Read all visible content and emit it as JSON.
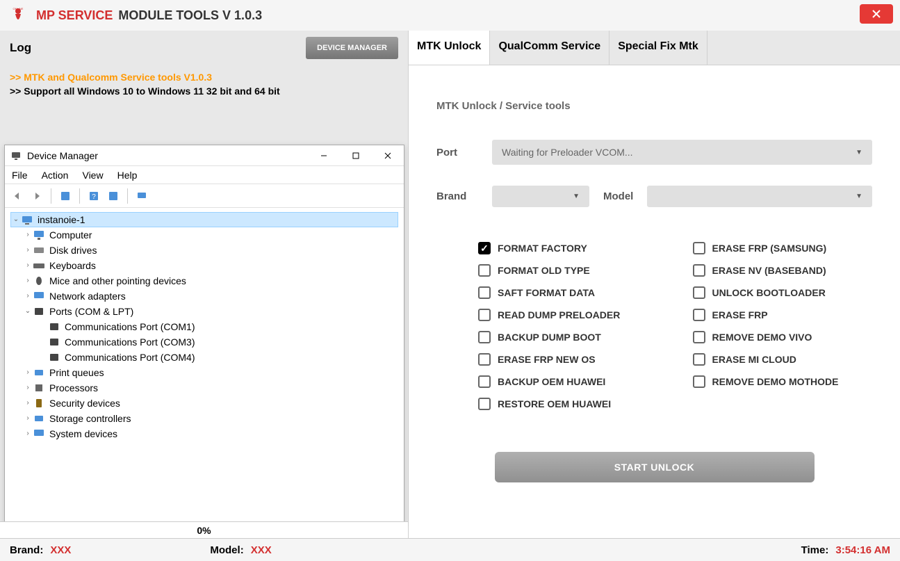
{
  "titlebar": {
    "main": "MP SERVICE",
    "sub": "MODULE TOOLS V 1.0.3",
    "logo_label": "ONLINE"
  },
  "left": {
    "log_label": "Log",
    "device_manager_btn": "DEVICE MANAGER",
    "log_lines": {
      "line1": ">> MTK and Qualcomm Service tools V1.0.3",
      "line2": ">> Support all Windows 10 to Windows 11 32 bit and 64 bit"
    },
    "progress": "0%"
  },
  "devmgr": {
    "title": "Device Manager",
    "menu": {
      "file": "File",
      "action": "Action",
      "view": "View",
      "help": "Help"
    },
    "root": "instanoie-1",
    "nodes": [
      {
        "label": "Computer",
        "icon": "monitor"
      },
      {
        "label": "Disk drives",
        "icon": "disk"
      },
      {
        "label": "Keyboards",
        "icon": "keyboard"
      },
      {
        "label": "Mice and other pointing devices",
        "icon": "mouse"
      },
      {
        "label": "Network adapters",
        "icon": "network"
      },
      {
        "label": "Ports (COM & LPT)",
        "icon": "port",
        "expanded": true,
        "children": [
          "Communications Port (COM1)",
          "Communications Port (COM3)",
          "Communications Port (COM4)"
        ]
      },
      {
        "label": "Print queues",
        "icon": "printer"
      },
      {
        "label": "Processors",
        "icon": "cpu"
      },
      {
        "label": "Security devices",
        "icon": "security"
      },
      {
        "label": "Storage controllers",
        "icon": "storage"
      },
      {
        "label": "System devices",
        "icon": "system"
      }
    ]
  },
  "tabs": {
    "t1": "MTK Unlock",
    "t2": "QualComm Service",
    "t3": "Special Fix Mtk"
  },
  "right": {
    "panel_title": "MTK Unlock / Service tools",
    "port_label": "Port",
    "port_value": "Waiting for Preloader VCOM...",
    "brand_label": "Brand",
    "model_label": "Model",
    "options_left": [
      {
        "label": "FORMAT FACTORY",
        "checked": true
      },
      {
        "label": "FORMAT OLD TYPE",
        "checked": false
      },
      {
        "label": "SAFT FORMAT DATA",
        "checked": false
      },
      {
        "label": "READ DUMP PRELOADER",
        "checked": false
      },
      {
        "label": "BACKUP DUMP BOOT",
        "checked": false
      },
      {
        "label": "ERASE FRP NEW OS",
        "checked": false
      },
      {
        "label": "BACKUP OEM HUAWEI",
        "checked": false
      },
      {
        "label": "RESTORE OEM HUAWEI",
        "checked": false
      }
    ],
    "options_right": [
      {
        "label": "ERASE FRP (SAMSUNG)",
        "checked": false
      },
      {
        "label": "ERASE NV (BASEBAND)",
        "checked": false
      },
      {
        "label": "UNLOCK BOOTLOADER",
        "checked": false
      },
      {
        "label": "ERASE FRP",
        "checked": false
      },
      {
        "label": "REMOVE DEMO VIVO",
        "checked": false
      },
      {
        "label": "ERASE MI CLOUD",
        "checked": false
      },
      {
        "label": "REMOVE DEMO MOTHODE",
        "checked": false
      }
    ],
    "start_btn": "START UNLOCK"
  },
  "statusbar": {
    "brand_label": "Brand:",
    "brand_value": "XXX",
    "model_label": "Model:",
    "model_value": "XXX",
    "time_label": "Time:",
    "time_value": "3:54:16 AM"
  }
}
